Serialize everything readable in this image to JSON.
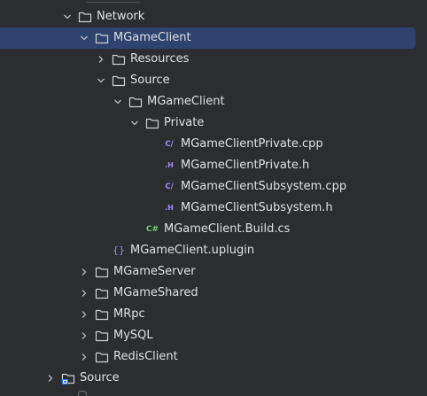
{
  "tree": {
    "items": [
      {
        "label": "Network",
        "icon": "folder-icon",
        "expanded": true
      },
      {
        "label": "MGameClient",
        "icon": "folder-icon",
        "expanded": true,
        "selected": true
      },
      {
        "label": "Resources",
        "icon": "folder-icon",
        "expanded": false
      },
      {
        "label": "Source",
        "icon": "folder-icon",
        "expanded": true
      },
      {
        "label": "MGameClient",
        "icon": "folder-icon",
        "expanded": true
      },
      {
        "label": "Private",
        "icon": "folder-icon",
        "expanded": true
      },
      {
        "label": "MGameClientPrivate.cpp",
        "icon": "cpp-file-icon",
        "badge": "C/"
      },
      {
        "label": "MGameClientPrivate.h",
        "icon": "header-file-icon",
        "badge": ".H"
      },
      {
        "label": "MGameClientSubsystem.cpp",
        "icon": "cpp-file-icon",
        "badge": "C/"
      },
      {
        "label": "MGameClientSubsystem.h",
        "icon": "header-file-icon",
        "badge": ".H"
      },
      {
        "label": "MGameClient.Build.cs",
        "icon": "csharp-file-icon",
        "badge": "C#"
      },
      {
        "label": "MGameClient.uplugin",
        "icon": "json-file-icon",
        "badge": "{}"
      },
      {
        "label": "MGameServer",
        "icon": "folder-icon",
        "expanded": false
      },
      {
        "label": "MGameShared",
        "icon": "folder-icon",
        "expanded": false
      },
      {
        "label": "MRpc",
        "icon": "folder-icon",
        "expanded": false
      },
      {
        "label": "MySQL",
        "icon": "folder-icon",
        "expanded": false
      },
      {
        "label": "RedisClient",
        "icon": "folder-icon",
        "expanded": false
      },
      {
        "label": "Source",
        "icon": "module-folder-icon",
        "expanded": false
      }
    ]
  },
  "colors": {
    "background": "#2b2d30",
    "selection": "#2e436e",
    "text": "#dfe1e5",
    "cpp_badge": "#a58cf1",
    "cs_badge": "#6fd06f"
  }
}
